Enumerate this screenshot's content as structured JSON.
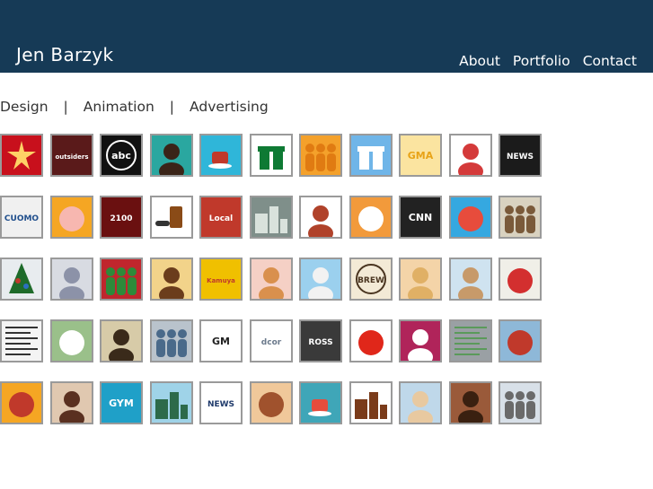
{
  "header": {
    "site_title": "Jen Barzyk",
    "nav": [
      "About",
      "Portfolio",
      "Contact"
    ],
    "background": "#163a56"
  },
  "categories": [
    "Design",
    "Animation",
    "Advertising"
  ],
  "separator": "|",
  "thumb_border_color": "#9a9a9a",
  "thumbnails": [
    [
      {
        "name": "red-star-thumb",
        "bg": "#c8101c",
        "fg": "#ffd166",
        "kind": "star",
        "text": ""
      },
      {
        "name": "outsiders-thumb",
        "bg": "#5a1a1a",
        "fg": "#ffffff",
        "kind": "text",
        "text": "outsiders"
      },
      {
        "name": "abc-logo-thumb",
        "bg": "#111111",
        "fg": "#ffffff",
        "kind": "circle-text",
        "text": "abc"
      },
      {
        "name": "afro-woman-thumb",
        "bg": "#2aa7a0",
        "fg": "#3a2418",
        "kind": "face",
        "text": ""
      },
      {
        "name": "coffee-cup-thumb",
        "bg": "#2fb6d9",
        "fg": "#c0392b",
        "kind": "cup",
        "text": ""
      },
      {
        "name": "gift-box-thumb",
        "bg": "#ffffff",
        "fg": "#0e7a34",
        "kind": "gift",
        "text": ""
      },
      {
        "name": "orange-figures-thumb",
        "bg": "#f4a12b",
        "fg": "#e07b12",
        "kind": "figures",
        "text": ""
      },
      {
        "name": "blue-gift-thumb",
        "bg": "#6fb5e8",
        "fg": "#ffffff",
        "kind": "gift",
        "text": ""
      },
      {
        "name": "gma-logo-thumb",
        "bg": "#fbe4a0",
        "fg": "#e8a317",
        "kind": "text",
        "text": "GMA"
      },
      {
        "name": "girl-photo-thumb",
        "bg": "#ffffff",
        "fg": "#d43a3a",
        "kind": "face",
        "text": ""
      },
      {
        "name": "news-video-thumb",
        "bg": "#1b1b1b",
        "fg": "#ffffff",
        "kind": "text",
        "text": "NEWS"
      }
    ],
    [
      {
        "name": "cuomo-case-thumb",
        "bg": "#f0f0f0",
        "fg": "#1f4e8c",
        "kind": "text",
        "text": "CUOMO"
      },
      {
        "name": "piggy-bank-thumb",
        "bg": "#f5a623",
        "fg": "#f7b7b0",
        "kind": "circle",
        "text": ""
      },
      {
        "name": "2100-thumb",
        "bg": "#6a1010",
        "fg": "#ffffff",
        "kind": "text",
        "text": "2100"
      },
      {
        "name": "pills-thumb",
        "bg": "#ffffff",
        "fg": "#8a4b17",
        "kind": "pills",
        "text": ""
      },
      {
        "name": "local-distributor-thumb",
        "bg": "#c0392b",
        "fg": "#ffffff",
        "kind": "text",
        "text": "Local"
      },
      {
        "name": "city-scene-thumb",
        "bg": "#7f8f8a",
        "fg": "#d9e2dc",
        "kind": "blocks",
        "text": ""
      },
      {
        "name": "woman-phone-thumb",
        "bg": "#ffffff",
        "fg": "#b0422a",
        "kind": "face",
        "text": ""
      },
      {
        "name": "hand-ring-thumb",
        "bg": "#f29a3b",
        "fg": "#ffffff",
        "kind": "circle",
        "text": ""
      },
      {
        "name": "cnn-logo-thumb",
        "bg": "#222222",
        "fg": "#ffffff",
        "kind": "text",
        "text": "CNN"
      },
      {
        "name": "ball-woman-thumb",
        "bg": "#35a8e0",
        "fg": "#e74c3c",
        "kind": "circle",
        "text": ""
      },
      {
        "name": "news-anchors-thumb",
        "bg": "#d9d2c0",
        "fg": "#7a5a3a",
        "kind": "figures",
        "text": ""
      }
    ],
    [
      {
        "name": "christmas-tree-thumb",
        "bg": "#e8ecef",
        "fg": "#1e6b2a",
        "kind": "tree",
        "text": ""
      },
      {
        "name": "sketch-man-thumb",
        "bg": "#d8dbe2",
        "fg": "#8c92a8",
        "kind": "face",
        "text": ""
      },
      {
        "name": "stockings-thumb",
        "bg": "#c0262d",
        "fg": "#2d8a3a",
        "kind": "figures",
        "text": ""
      },
      {
        "name": "smiling-man-thumb",
        "bg": "#f2d38a",
        "fg": "#6b3d1c",
        "kind": "face",
        "text": ""
      },
      {
        "name": "kamuya-thumb",
        "bg": "#f0c000",
        "fg": "#c0392b",
        "kind": "text",
        "text": "Kamuya"
      },
      {
        "name": "cartoon-woman-thumb",
        "bg": "#f5d0c5",
        "fg": "#d9904d",
        "kind": "face",
        "text": ""
      },
      {
        "name": "yoga-thumb",
        "bg": "#9bd0ee",
        "fg": "#f2f2f2",
        "kind": "face",
        "text": ""
      },
      {
        "name": "brewing-label-thumb",
        "bg": "#f3ead6",
        "fg": "#4a3520",
        "kind": "circle-text",
        "text": "BREW"
      },
      {
        "name": "blonde-woman-thumb",
        "bg": "#f4d4a8",
        "fg": "#e0b065",
        "kind": "face",
        "text": ""
      },
      {
        "name": "smiling-woman-thumb",
        "bg": "#cfe3f0",
        "fg": "#c79a6a",
        "kind": "face",
        "text": ""
      },
      {
        "name": "red-circle-woman-thumb",
        "bg": "#f0efe8",
        "fg": "#d32f2f",
        "kind": "circle",
        "text": ""
      }
    ],
    [
      {
        "name": "newspaper-thumb",
        "bg": "#f4f4f4",
        "fg": "#333333",
        "kind": "lines",
        "text": ""
      },
      {
        "name": "plant-sketch-thumb",
        "bg": "#9ac08a",
        "fg": "#ffffff",
        "kind": "circle",
        "text": ""
      },
      {
        "name": "old-portrait-thumb",
        "bg": "#d7cba8",
        "fg": "#3a2a1a",
        "kind": "face",
        "text": ""
      },
      {
        "name": "family-photo-thumb",
        "bg": "#b9c3cc",
        "fg": "#4a6a8a",
        "kind": "figures",
        "text": ""
      },
      {
        "name": "general-motors-thumb",
        "bg": "#ffffff",
        "fg": "#222222",
        "kind": "text",
        "text": "GM"
      },
      {
        "name": "dcor-logo-thumb",
        "bg": "#ffffff",
        "fg": "#6b7a8c",
        "kind": "text",
        "text": "dcor"
      },
      {
        "name": "ross-logo-thumb",
        "bg": "#3a3a3a",
        "fg": "#ffffff",
        "kind": "text",
        "text": "ROSS"
      },
      {
        "name": "tomato-thumb",
        "bg": "#ffffff",
        "fg": "#e0271a",
        "kind": "circle",
        "text": ""
      },
      {
        "name": "clock-woman-thumb",
        "bg": "#b0245a",
        "fg": "#ffffff",
        "kind": "face",
        "text": ""
      },
      {
        "name": "map-thumb",
        "bg": "#9aa0a4",
        "fg": "#5a9a5a",
        "kind": "lines",
        "text": ""
      },
      {
        "name": "car-map-thumb",
        "bg": "#8eb8d8",
        "fg": "#c0392b",
        "kind": "circle",
        "text": ""
      }
    ],
    [
      {
        "name": "spaghetti-thumb",
        "bg": "#f5a623",
        "fg": "#c0392b",
        "kind": "circle",
        "text": ""
      },
      {
        "name": "laughing-woman-thumb",
        "bg": "#e0c8b0",
        "fg": "#5a3020",
        "kind": "face",
        "text": ""
      },
      {
        "name": "gym-talk-thumb",
        "bg": "#1fa0c8",
        "fg": "#ffffff",
        "kind": "text",
        "text": "GYM"
      },
      {
        "name": "airplane-thumb",
        "bg": "#9fd3e8",
        "fg": "#2d6a4a",
        "kind": "blocks",
        "text": ""
      },
      {
        "name": "news-logo-thumb",
        "bg": "#ffffff",
        "fg": "#1f3a6b",
        "kind": "text",
        "text": "NEWS"
      },
      {
        "name": "plated-dish-thumb",
        "bg": "#f0c89a",
        "fg": "#a0522d",
        "kind": "circle",
        "text": ""
      },
      {
        "name": "cocktail-tv-thumb",
        "bg": "#3fa6b8",
        "fg": "#e74c3c",
        "kind": "cup",
        "text": ""
      },
      {
        "name": "cake-slice-thumb",
        "bg": "#ffffff",
        "fg": "#7a3b1a",
        "kind": "blocks",
        "text": ""
      },
      {
        "name": "tv-host-thumb",
        "bg": "#bfd8ea",
        "fg": "#e8c9a0",
        "kind": "face",
        "text": ""
      },
      {
        "name": "woman-portrait-thumb",
        "bg": "#9a5a3a",
        "fg": "#3a2010",
        "kind": "face",
        "text": ""
      },
      {
        "name": "coat-figure-thumb",
        "bg": "#d8e0e8",
        "fg": "#6a6a6a",
        "kind": "figures",
        "text": ""
      }
    ]
  ]
}
